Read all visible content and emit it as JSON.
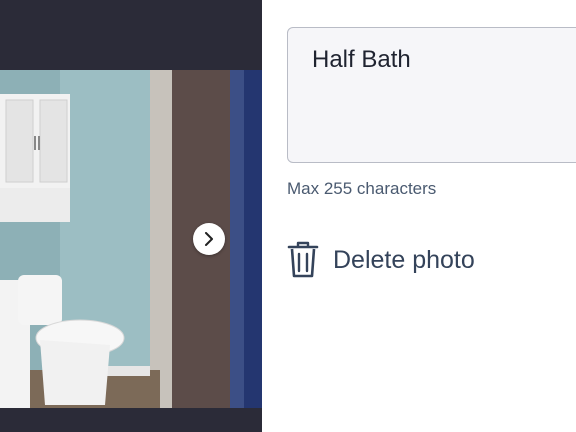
{
  "photo": {
    "subject": "bathroom-photo",
    "next_icon": "chevron-right-icon"
  },
  "caption": {
    "value": "Half Bath",
    "helper": "Max 255 characters"
  },
  "actions": {
    "delete_label": "Delete photo",
    "delete_icon": "trash-icon"
  },
  "colors": {
    "viewer_bg": "#2b2b38",
    "text": "#1f2330",
    "muted": "#4a5a70",
    "field_bg": "#f6f6f9"
  }
}
